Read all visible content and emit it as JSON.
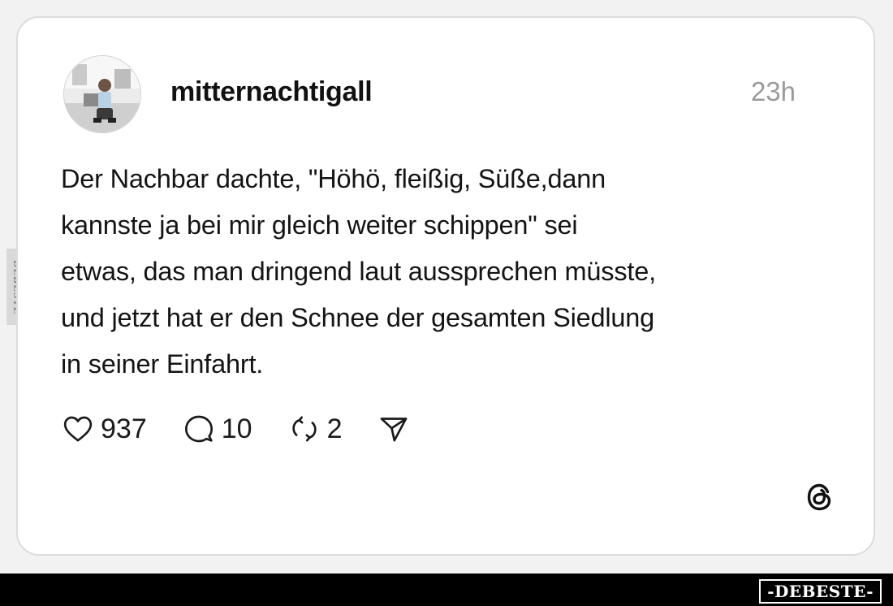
{
  "post": {
    "username": "mitternachtigall",
    "timestamp": "23h",
    "text_lines": [
      "Der Nachbar dachte, \"Höhö, fleißig, Süße,dann",
      "kannste ja bei mir gleich weiter schippen\" sei",
      "etwas, das man dringend laut aussprechen müsste,",
      "und jetzt hat er den Schnee der gesamten Siedlung",
      "in seiner Einfahrt."
    ],
    "likes": "937",
    "comments": "10",
    "reposts": "2"
  },
  "icons": {
    "like": "heart-icon",
    "comment": "comment-bubble-icon",
    "repost": "repost-icon",
    "share": "send-icon",
    "brand": "threads-logo-icon"
  },
  "watermark": {
    "side_text": "DEBESTE",
    "footer_text": "-DEBESTE-"
  },
  "colors": {
    "card_background": "#ffffff",
    "text": "#141414",
    "muted": "#9a9a9a",
    "footer": "#000000"
  }
}
